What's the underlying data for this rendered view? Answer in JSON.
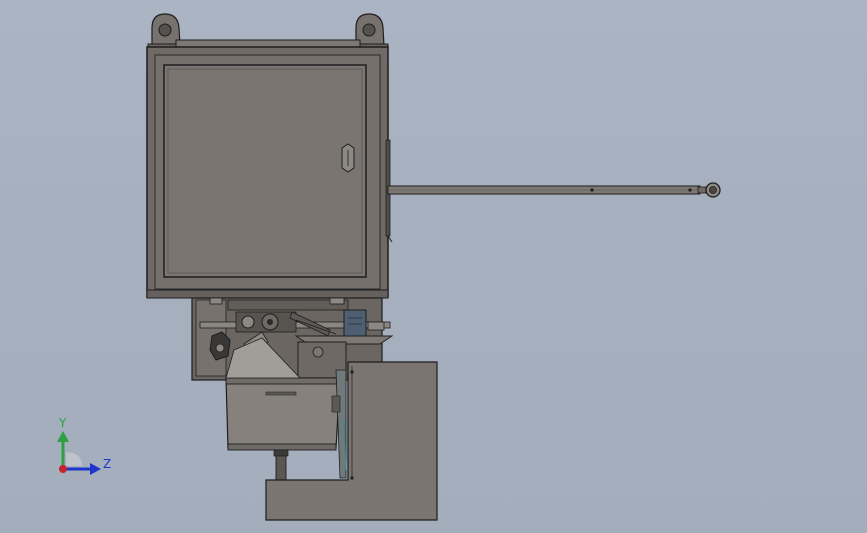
{
  "triad": {
    "y_label": "Y",
    "z_label": "Z",
    "y_color": "#2ea043",
    "z_color": "#1f35c9",
    "origin_color": "#c8232c"
  },
  "colors": {
    "background": "#a6b0bf",
    "body": "#6f6a66",
    "panel": "#7a7571",
    "outline": "#1e1e1e",
    "light_part": "#8c8884",
    "accent_blue": "#4e5f72",
    "accent_teal": "#3f8a86"
  }
}
